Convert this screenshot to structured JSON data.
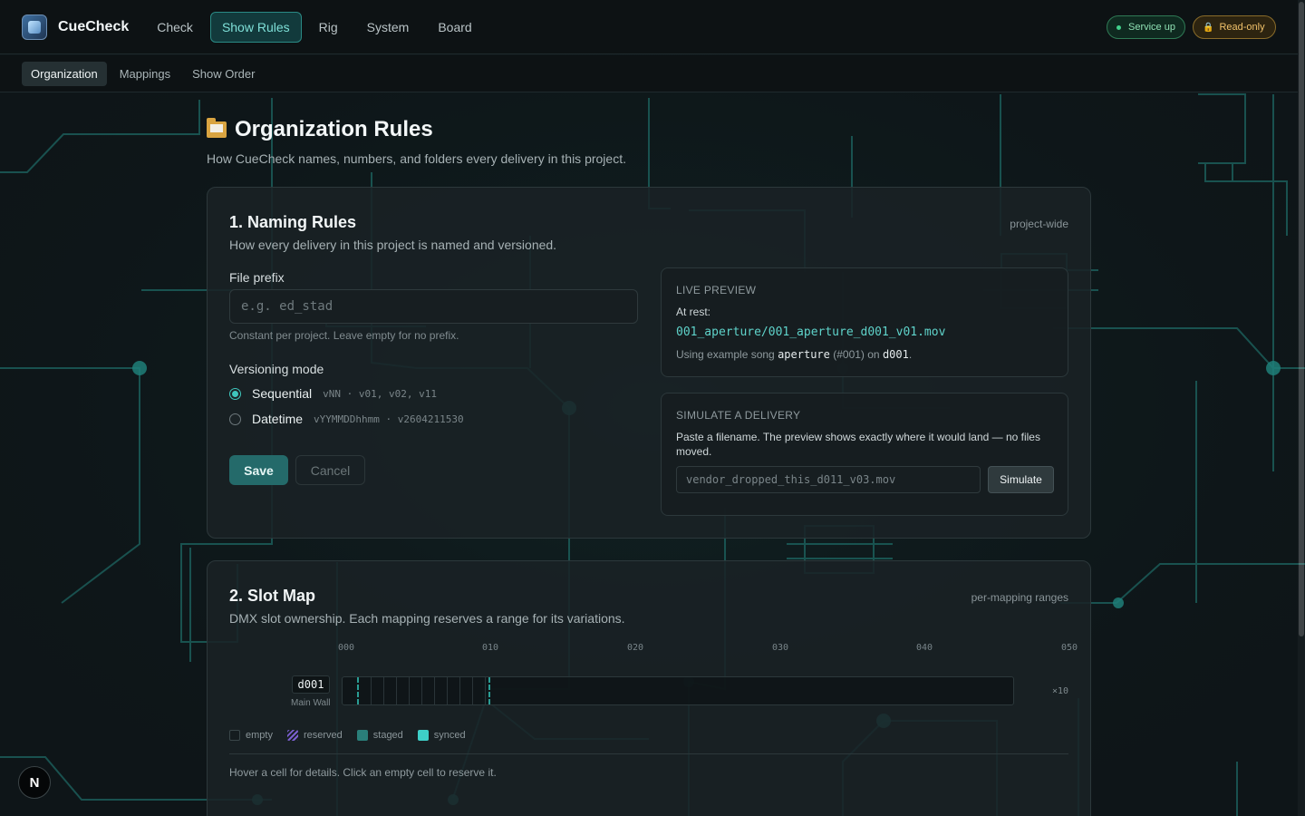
{
  "app": {
    "name": "CueCheck"
  },
  "nav": {
    "items": [
      "Check",
      "Show Rules",
      "Rig",
      "System",
      "Board"
    ],
    "active": "Show Rules"
  },
  "status": {
    "service": "Service up",
    "mode": "Read-only"
  },
  "subnav": {
    "items": [
      "Organization",
      "Mappings",
      "Show Order"
    ],
    "active": "Organization"
  },
  "page": {
    "title": "Organization Rules",
    "subtitle": "How CueCheck names, numbers, and folders every delivery in this project."
  },
  "naming": {
    "title": "1. Naming Rules",
    "tag": "project-wide",
    "description": "How every delivery in this project is named and versioned.",
    "prefix_label": "File prefix",
    "prefix_placeholder": "e.g. ed_stad",
    "prefix_hint": "Constant per project. Leave empty for no prefix.",
    "mode_label": "Versioning mode",
    "modes": [
      {
        "label": "Sequential",
        "format": "vNN · v01, v02, v11",
        "selected": true
      },
      {
        "label": "Datetime",
        "format": "vYYMMDDhhmm · v2604211530",
        "selected": false
      }
    ],
    "save": "Save",
    "cancel": "Cancel",
    "preview": {
      "heading": "LIVE PREVIEW",
      "rest_label": "At rest:",
      "path": "001_aperture/001_aperture_d001_v01.mov",
      "using_prefix": "Using example song",
      "song": "aperture",
      "song_num": "(#001) on",
      "device": "d001",
      "period": "."
    },
    "simulate": {
      "heading": "SIMULATE A DELIVERY",
      "description": "Paste a filename. The preview shows exactly where it would land — no files moved.",
      "placeholder": "vendor_dropped_this_d011_v03.mov",
      "button": "Simulate"
    }
  },
  "slotmap": {
    "title": "2. Slot Map",
    "tag": "per-mapping ranges",
    "description": "DMX slot ownership. Each mapping reserves a range for its variations.",
    "ticks": [
      "000",
      "010",
      "020",
      "030",
      "040",
      "050"
    ],
    "row": {
      "id": "d001",
      "name": "Main Wall",
      "count": "×10"
    },
    "legend": [
      "empty",
      "reserved",
      "staged",
      "synced"
    ],
    "hint": "Hover a cell for details. Click an empty cell to reserve it."
  },
  "colors": {
    "accent": "#3fc6bd",
    "background": "#0f1417",
    "service_ok": "#41d18b",
    "readonly": "#f0c16a"
  }
}
